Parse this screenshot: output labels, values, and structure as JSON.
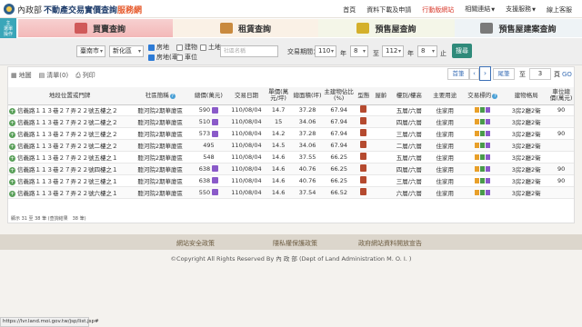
{
  "header": {
    "org": "內政部",
    "title_main": "不動產交易實價查詢",
    "title_accent": "服務網",
    "nav": [
      "首頁",
      "資料下載及申請",
      "行動版網站",
      "相關連結",
      "支援服務",
      "線上客服"
    ]
  },
  "quick_menu": [
    "主",
    "選單",
    "操作"
  ],
  "tabs": [
    "買賣查詢",
    "租賃查詢",
    "預售屋查詢",
    "預售屋建案查詢"
  ],
  "filters": {
    "city": "臺南市",
    "district": "新化區",
    "type_options": [
      "房地",
      "建物",
      "土地",
      "房地(車)",
      "車位"
    ],
    "search_placeholder": "社區名稱",
    "period_label": "交易期間：",
    "from_year": "110",
    "year_label": "年",
    "from_month": "8",
    "to_label": "至",
    "to_year": "112",
    "to_month": "8",
    "end_label": "止",
    "search_button": "搜尋"
  },
  "view_tabs": [
    "地圖",
    "清單(0)",
    "列印"
  ],
  "pager": {
    "first": "首筆",
    "last": "尾筆",
    "to": "至",
    "page": "3",
    "unit": "頁",
    "go": "GO"
  },
  "table": {
    "headers": [
      "地段位置或門牌",
      "社區簡稱",
      "總價(萬元)",
      "交易日期",
      "單價(萬元/坪)",
      "總面積(坪)",
      "主建物佔比(%)",
      "型態",
      "屋齡",
      "樓別/樓高",
      "主要用途",
      "交易標的",
      "建物格局",
      "車位總價(萬元)"
    ],
    "rows": [
      {
        "addr": "信義路１１３巷２７弄２２號五樓之２",
        "community": "聽河院2期華廈區",
        "price": "590",
        "date": "110/08/04",
        "unit": "14.7",
        "area": "37.28",
        "ratio": "67.94",
        "floor": "五層/六層",
        "use": "住家用",
        "layout": "3房2廳2衛",
        "parking": "90"
      },
      {
        "addr": "信義路１１３巷２７弄２２號二樓之２",
        "community": "聽河院2期華廈區",
        "price": "510",
        "date": "110/08/04",
        "unit": "15",
        "area": "34.06",
        "ratio": "67.94",
        "floor": "四層/六層",
        "use": "住家用",
        "layout": "3房2廳2衛",
        "parking": ""
      },
      {
        "addr": "信義路１１３巷２７弄２２號三樓之２",
        "community": "聽河院2期華廈區",
        "price": "573",
        "date": "110/08/04",
        "unit": "14.2",
        "area": "37.28",
        "ratio": "67.94",
        "floor": "三層/六層",
        "use": "住家用",
        "layout": "3房2廳2衛",
        "parking": "90"
      },
      {
        "addr": "信義路１１３巷２７弄２２號二樓之２",
        "community": "聽河院2期華廈區",
        "price": "495",
        "date": "110/08/04",
        "unit": "14.5",
        "area": "34.06",
        "ratio": "67.94",
        "floor": "二層/六層",
        "use": "住家用",
        "layout": "3房2廳2衛",
        "parking": ""
      },
      {
        "addr": "信義路１１３巷２７弄２２號五樓之１",
        "community": "聽河院2期華廈區",
        "price": "548",
        "date": "110/08/04",
        "unit": "14.6",
        "area": "37.55",
        "ratio": "66.25",
        "floor": "五層/六層",
        "use": "住家用",
        "layout": "3房2廳2衛",
        "parking": ""
      },
      {
        "addr": "信義路１１３巷２７弄２２號四樓之１",
        "community": "聽河院2期華廈區",
        "price": "638",
        "date": "110/08/04",
        "unit": "14.6",
        "area": "40.76",
        "ratio": "66.25",
        "floor": "四層/六層",
        "use": "住家用",
        "layout": "3房2廳2衛",
        "parking": "90"
      },
      {
        "addr": "信義路１１３巷２７弄２２號三樓之１",
        "community": "聽河院2期華廈區",
        "price": "638",
        "date": "110/08/04",
        "unit": "14.6",
        "area": "40.76",
        "ratio": "66.25",
        "floor": "三層/六層",
        "use": "住家用",
        "layout": "3房2廳2衛",
        "parking": "90"
      },
      {
        "addr": "信義路１１３巷２７弄２２號六樓之１",
        "community": "聽河院2期華廈區",
        "price": "550",
        "date": "110/08/04",
        "unit": "14.6",
        "area": "37.54",
        "ratio": "66.52",
        "floor": "六層/六層",
        "use": "住家用",
        "layout": "3房2廳2衛",
        "parking": ""
      }
    ]
  },
  "records_note": "顯示 31 至 38 筆 (查詢結果　38 筆)",
  "footer": {
    "links": [
      "網站安全政策",
      "隱私權保護政策",
      "政府網站資料開放宣告"
    ],
    "copyright": "©Copyright All Rights Reserved By 內 政 部 (Dept of Land Administration M. O. I. )"
  },
  "status_url": "https://lvr.land.moi.gov.tw/jsp/list.jsp#"
}
